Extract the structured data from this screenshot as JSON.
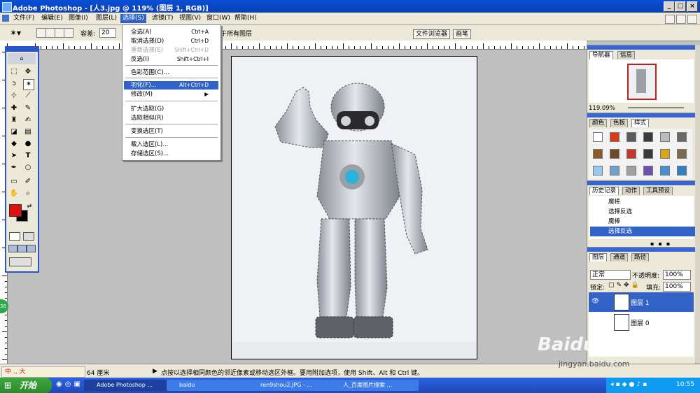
{
  "titlebar": {
    "title": "Adobe Photoshop - [人3.jpg @ 119% (图层 1, RGB)]",
    "min": "_",
    "max": "□",
    "close": "×"
  },
  "menubar": {
    "items": [
      "文件(F)",
      "编辑(E)",
      "图像(I)",
      "图层(L)",
      "选择(S)",
      "滤镜(T)",
      "视图(V)",
      "窗口(W)",
      "帮助(H)"
    ],
    "active": "选择(S)"
  },
  "options": {
    "tolerance_label": "容差:",
    "tolerance_value": "20",
    "all_layers_label": "于所有图层",
    "file_browser_tab": "文件浏览器",
    "brush_tab": "画笔"
  },
  "select_menu": {
    "items": [
      {
        "label": "全选(A)",
        "shortcut": "Ctrl+A",
        "disabled": false
      },
      {
        "label": "取消选择(D)",
        "shortcut": "Ctrl+D",
        "disabled": false
      },
      {
        "label": "重新选择(E)",
        "shortcut": "Shift+Ctrl+D",
        "disabled": true
      },
      {
        "label": "反选(I)",
        "shortcut": "Shift+Ctrl+I",
        "disabled": false
      },
      {
        "label": "色彩范围(C)...",
        "shortcut": "",
        "disabled": false
      },
      {
        "label": "羽化(F)...",
        "shortcut": "Alt+Ctrl+D",
        "disabled": false,
        "selected": true
      },
      {
        "label": "修改(M)",
        "shortcut": "▶",
        "disabled": false
      },
      {
        "label": "扩大选取(G)",
        "shortcut": "",
        "disabled": false
      },
      {
        "label": "选取相似(R)",
        "shortcut": "",
        "disabled": false
      },
      {
        "label": "变换选区(T)",
        "shortcut": "",
        "disabled": false
      },
      {
        "label": "载入选区(L)...",
        "shortcut": "",
        "disabled": false
      },
      {
        "label": "存储选区(S)...",
        "shortcut": "",
        "disabled": false
      }
    ]
  },
  "navigator": {
    "tabs": [
      "导航器",
      "信息"
    ],
    "zoom": "119.09%"
  },
  "color_panel": {
    "tabs": [
      "颜色",
      "色板",
      "样式"
    ],
    "swatches": [
      "#ffffff",
      "#d83a1e",
      "#5a5a5a",
      "#3a3a3a",
      "#bcbcbc",
      "#6a6a6a",
      "#8b5a2b",
      "#6e4a2a",
      "#c0392b",
      "#3a3a3a",
      "#d9a520",
      "#7a6a50",
      "#9ac8ee",
      "#6fa0c8",
      "#a0a0a0",
      "#7050b0",
      "#4a90d0",
      "#3080c0"
    ]
  },
  "history": {
    "tabs": [
      "历史记录",
      "动作",
      "工具预设"
    ],
    "items": [
      "魔棒",
      "选择反选",
      "魔棒",
      "选择反选"
    ],
    "active_index": 3
  },
  "layers": {
    "tabs": [
      "图层",
      "通道",
      "路径"
    ],
    "blend_mode": "正常",
    "opacity_label": "不透明度:",
    "opacity_value": "100%",
    "lock_label": "锁定:",
    "fill_label": "填充:",
    "fill_value": "100%",
    "items": [
      "图层 1",
      "图层 0"
    ],
    "active_index": 0
  },
  "statusbar": {
    "zoom": "64 厘米",
    "hint": "点按以选择相同颜色的邻近像素或移动选区外框。要用附加选项，使用 Shift、Alt 和 Ctrl 键。",
    "ime": "中 ., 大"
  },
  "taskbar": {
    "start": "开始",
    "tasks": [
      "Adobe Photoshop ...",
      "baidu",
      "ren9shou2.JPG - ...",
      "人_百度图片搜索 ..."
    ],
    "active_index": 0,
    "time": "10:55"
  },
  "watermark": {
    "logo": "Baidu 经验",
    "url": "jingyan.baidu.com"
  },
  "colors": {
    "foreground": "#e01010",
    "background": "#000000",
    "accent": "#3163c6"
  }
}
